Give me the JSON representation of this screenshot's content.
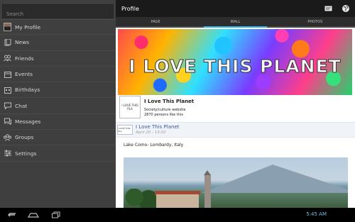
{
  "sidebar": {
    "search": {
      "placeholder": "Search",
      "value": ""
    },
    "items": [
      {
        "label": "My Profile",
        "icon": "avatar"
      },
      {
        "label": "News",
        "icon": "news-icon"
      },
      {
        "label": "Friends",
        "icon": "friends-icon"
      },
      {
        "label": "Events",
        "icon": "events-icon"
      },
      {
        "label": "Birthdays",
        "icon": "birthdays-icon"
      },
      {
        "label": "Chat",
        "icon": "chat-icon"
      },
      {
        "label": "Messages",
        "icon": "messages-icon"
      },
      {
        "label": "Groups",
        "icon": "groups-icon"
      },
      {
        "label": "Settings",
        "icon": "settings-icon"
      }
    ]
  },
  "header": {
    "title": "Profile",
    "icons": [
      "compose-icon",
      "globe-icon"
    ]
  },
  "tabs": [
    {
      "label": "PAGE",
      "active": false
    },
    {
      "label": "WALL",
      "active": true
    },
    {
      "label": "PHOTOS",
      "active": false
    }
  ],
  "profile": {
    "cover_text": "I LOVE THIS PLANET",
    "thumb_text": "I LOVE THIS PLA",
    "name": "I Love This Planet",
    "category": "Society/culture website",
    "likes": "2870 persons like this"
  },
  "post": {
    "thumb_text": "I LOVE THIS PLA",
    "author": "I Love This Planet",
    "date": "April 20 - 13:02",
    "text": "Lake Como- Lombardy, Italy"
  },
  "system": {
    "clock": "5:45 AM",
    "nav_icons": [
      "back-icon",
      "home-icon",
      "recent-apps-icon"
    ]
  },
  "colors": {
    "accent": "#33b5e5",
    "link": "#3b5998",
    "sidebar_bg": "#3f3f3f",
    "topbar_bg": "#1a1a1a"
  }
}
